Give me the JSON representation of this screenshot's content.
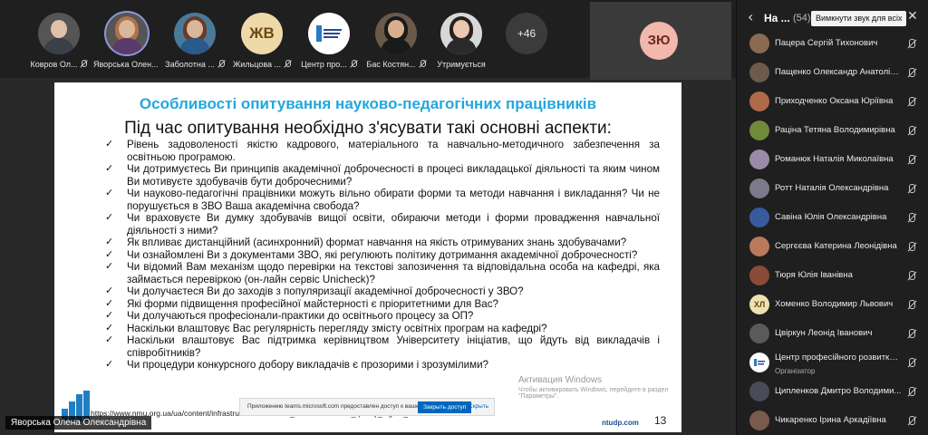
{
  "participants_strip": [
    {
      "name": "Ковров Ол...",
      "avatar": "photo",
      "muted": true
    },
    {
      "name": "Яворська Олен...",
      "avatar": "photo",
      "muted": true,
      "speaking": true
    },
    {
      "name": "Заболотна ...",
      "avatar": "photo",
      "muted": true
    },
    {
      "name": "Жильцова ...",
      "avatar": "ЖВ",
      "muted": true
    },
    {
      "name": "Центр про...",
      "avatar": "logo",
      "muted": true
    },
    {
      "name": "Бас Костян...",
      "avatar": "photo",
      "muted": true
    },
    {
      "name": "Утримується",
      "avatar": "photo",
      "muted": false
    },
    {
      "name": "",
      "avatar": "+46",
      "muted": false
    }
  ],
  "self_tile": {
    "initials": "ЗЮ"
  },
  "slide": {
    "title": "Особливості опитування науково-педагогічних працівників",
    "subtitle": "Під час опитування необхідно з'ясувати такі основні аспекти:",
    "items": [
      "Рівень задоволеності якістю кадрового, матеріального та навчально-методичного забезпечення за освітньою програмою.",
      "Чи дотримуєтесь Ви принципів академічної доброчесності в процесі викладацької діяльності та яким чином Ви мотивуєте здобувачів бути доброчесними?",
      "Чи науково-педагогічні працівники можуть вільно обирати форми та методи навчання і викладання? Чи не порушується в ЗВО Ваша академічна свобода?",
      "Чи враховуєте Ви думку здобувачів вищої освіти, обираючи методи і форми провадження навчальної діяльності з ними?",
      "Як впливає дистанційний (асинхронний) формат навчання на якість отримуваних знань здобувачами?",
      "Чи ознайомлені Ви з документами ЗВО, які регулюють політику дотримання академічної доброчесності?",
      "Чи відомий Вам механізм щодо перевірки на текстові запозичення та відповідальна особа на кафедрі, яка займається перевіркою (он-лайн сервіс Unicheck)?",
      "Чи долучаєтеся Ви до заходів з популяризації академічної доброчесності у ЗВО?",
      "Які форми підвищення професійної майстерності є пріоритетними для Вас?",
      "Чи долучаються професіонали-практики до освітнього процесу за ОП?",
      "Наскільки влаштовує Вас регулярність перегляду змісту освітніх програм на кафедрі?",
      "Наскільки влаштовує Вас підтримка керівництвом Університету ініціатив, що йдуть від викладачів і співробітників?",
      "Чи процедури конкурсного добору викладачів є прозорими і зрозумілими?"
    ],
    "activation_title": "Активация Windows",
    "activation_sub": "Чтобы активировать Windows, перейдите в раздел \"Параметры\".",
    "url": "https://www.nmu.org.ua/ua/content/infrastructure/structural_divisions/internal_quality_higher_education",
    "site": "ntudp.com",
    "page_number": "13",
    "infobar_text": "Приложению teams.microsoft.com предоставлен доступ к вашему экрану.",
    "infobar_button": "Закрыть доступ",
    "infobar_reset": "Скрыть"
  },
  "presenter_label": "Яворська Олена Олександрівна",
  "panel": {
    "title": "На ...",
    "count": "(54)",
    "mute_all_label": "Вимкнути звук для всіх",
    "people": [
      {
        "name": "Пацера Сергій Тихонович",
        "avatar": "photo",
        "color": "#8a6a52"
      },
      {
        "name": "Пащенко Олександр Анатолій...",
        "avatar": "photo",
        "color": "#6c5a4c"
      },
      {
        "name": "Приходченко Оксана Юріївна",
        "avatar": "photo",
        "color": "#b06a4a"
      },
      {
        "name": "Раціна Тетяна Володимирівна",
        "avatar": "photo",
        "color": "#6f8a3a"
      },
      {
        "name": "Романюк Наталія Миколаївна",
        "avatar": "photo",
        "color": "#9a8aa8"
      },
      {
        "name": "Ротт Наталія Олександрівна",
        "avatar": "photo",
        "color": "#7a7a8a"
      },
      {
        "name": "Савіна Юлія Олександрівна",
        "avatar": "photo",
        "color": "#3a5aa0"
      },
      {
        "name": "Сергєєва Катерина Леонідівна",
        "avatar": "photo",
        "color": "#b87a5a"
      },
      {
        "name": "Тюря Юлія Іванівна",
        "avatar": "photo",
        "color": "#8a4a3a"
      },
      {
        "name": "Хоменко Володимир Львович",
        "avatar": "ХЛ",
        "color": "#efe0b0"
      },
      {
        "name": "Цвіркун Леонід Іванович",
        "avatar": "photo",
        "color": "#5a5a5a"
      },
      {
        "name": "Центр професійного розвитку ...",
        "role": "Організатор",
        "avatar": "logo",
        "color": "#ffffff"
      },
      {
        "name": "Ципленков Дмитро Володими...",
        "avatar": "photo",
        "color": "#4a4a5a"
      },
      {
        "name": "Чикаренко Ірина Аркадіївна",
        "avatar": "photo",
        "color": "#7a5a4a"
      }
    ]
  },
  "colors": {
    "accent_title": "#22a7de",
    "speaking_ring": "#8f96d8",
    "stage_bg": "#292929"
  }
}
